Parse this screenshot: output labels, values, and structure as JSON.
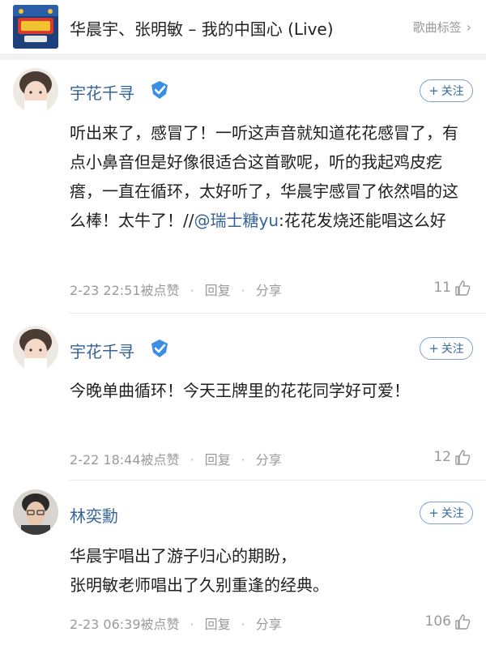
{
  "song": {
    "title": "华晨宇、张明敏 – 我的中国心 (Live)",
    "tag_label": "歌曲标签",
    "tag_chevron": "chevron-right-icon"
  },
  "comments": [
    {
      "username": "宇花千寻",
      "verified": true,
      "follow_label": "关注",
      "text": "听出来了，感冒了！一听这声音就知道花花感冒了，有点小鼻音但是好像很适合这首歌呢，听的我起鸡皮疙瘩，一直在循环，太好听了，华晨宇感冒了依然唱的这么棒！太牛了！//",
      "mention": "@瑞士糖yu",
      "text_after": ":花花发烧还能唱这么好",
      "time": "2-23 22:51",
      "like_label": "被点赞",
      "reply_label": "回复",
      "share_label": "分享",
      "likes": "11"
    },
    {
      "username": "宇花千寻",
      "verified": true,
      "follow_label": "关注",
      "text": "今晚单曲循环！今天王牌里的花花同学好可爱！",
      "time": "2-22 18:44",
      "like_label": "被点赞",
      "reply_label": "回复",
      "share_label": "分享",
      "likes": "12"
    },
    {
      "username": "林奕勳",
      "verified": false,
      "follow_label": "关注",
      "text_line1": "华晨宇唱出了游子归心的期盼，",
      "text_line2": "张明敏老师唱出了久别重逢的经典。",
      "time": "2-23 06:39",
      "like_label": "被点赞",
      "reply_label": "回复",
      "share_label": "分享",
      "likes": "106"
    }
  ],
  "colors": {
    "username": "#36639a",
    "meta": "#9a9a9a",
    "follow_border": "#7fa2c8",
    "verify_badge": "#3a8ee6"
  }
}
